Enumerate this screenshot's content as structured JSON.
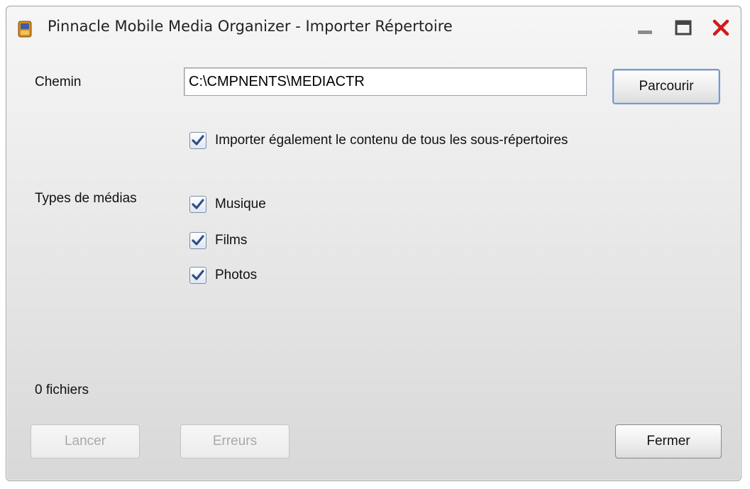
{
  "window": {
    "title": "Pinnacle Mobile Media Organizer - Importer Répertoire",
    "icons": {
      "app": "pinnacle-app-icon",
      "minimize": "minimize-icon",
      "maximize": "maximize-icon",
      "close": "close-icon"
    },
    "colors": {
      "close": "#d11a1a",
      "focus_border": "#7d98c5"
    }
  },
  "path": {
    "label": "Chemin",
    "value": "C:\\CMPNENTS\\MEDIACTR",
    "browse_label": "Parcourir"
  },
  "subdirs": {
    "label": "Importer également le contenu de tous les sous-répertoires",
    "checked": true
  },
  "media": {
    "label": "Types de médias",
    "types": [
      {
        "label": "Musique",
        "checked": true
      },
      {
        "label": "Films",
        "checked": true
      },
      {
        "label": "Photos",
        "checked": true
      }
    ]
  },
  "status": {
    "count_text": "0 fichiers"
  },
  "buttons": {
    "launch": "Lancer",
    "errors": "Erreurs",
    "close": "Fermer"
  }
}
